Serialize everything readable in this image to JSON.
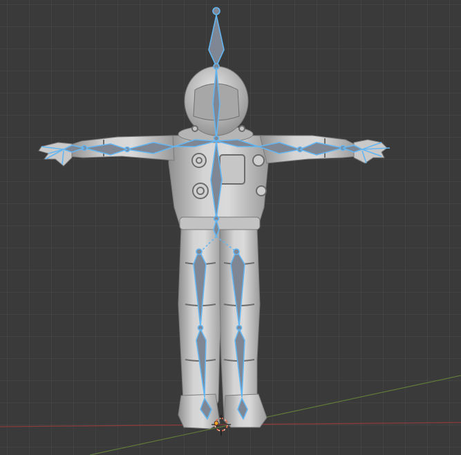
{
  "viewport": {
    "mode": "3d-viewport",
    "background": "#3a3a3a"
  },
  "colors": {
    "bone_fill": "#7f8794",
    "bone_outline": "#63b6f2",
    "mesh_light": "#d7d7d7",
    "mesh_mid": "#b8b8b8",
    "mesh_dark": "#8c8c8c",
    "axis_x": "#8a3b3b",
    "axis_y": "#5f7a3a",
    "origin_cursor": "#e06a4a"
  },
  "scene": {
    "object": "astronaut-mesh",
    "armature": "rig-armature"
  }
}
